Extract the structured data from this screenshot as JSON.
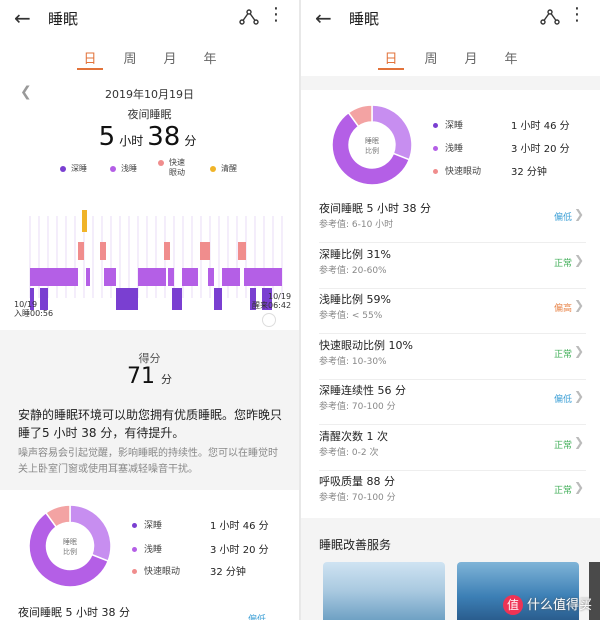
{
  "app": {
    "title": "睡眠"
  },
  "tabs": [
    "日",
    "周",
    "月",
    "年"
  ],
  "active_tab": "日",
  "day": {
    "date": "2019年10月19日",
    "night_sleep_label": "夜间睡眠",
    "duration": {
      "hours": "5",
      "hours_unit": "小时",
      "minutes": "38",
      "minutes_unit": "分"
    },
    "legend": [
      {
        "label": "深睡",
        "color": "#7a3fd1"
      },
      {
        "label": "浅睡",
        "color": "#b45fe6"
      },
      {
        "label": "快速\n眼动",
        "color": "#f08d8d"
      },
      {
        "label": "清醒",
        "color": "#f0b429"
      }
    ],
    "start_label": "10/19\n入睡00:56",
    "end_label": "10/19\n醒来06:42",
    "score_label": "得分",
    "score": "71",
    "score_unit": "分",
    "advice": "安静的睡眠环境可以助您拥有优质睡眠。您昨晚只睡了5 小时 38 分，有待提升。",
    "advice_detail": "噪声容易会引起觉醒，影响睡眠的持续性。您可以在睡觉时关上卧室门窗或使用耳塞减轻噪音干扰。"
  },
  "donut": {
    "center_label": "睡眠\n比例",
    "slices": [
      {
        "label": "深睡",
        "value": "1 小时 46 分",
        "percent": 31,
        "color": "#c78ef0"
      },
      {
        "label": "浅睡",
        "value": "3 小时 20 分",
        "percent": 59,
        "color": "#b45fe6"
      },
      {
        "label": "快速眼动",
        "value": "32 分钟",
        "percent": 10,
        "color": "#f3a3a3"
      }
    ]
  },
  "metrics": [
    {
      "title": "夜间睡眠  5 小时 38 分",
      "ref": "参考值: 6-10 小时",
      "status": "偏低",
      "level": "low"
    },
    {
      "title": "深睡比例  31%",
      "ref": "参考值: 20-60%",
      "status": "正常",
      "level": "norm"
    },
    {
      "title": "浅睡比例  59%",
      "ref": "参考值: < 55%",
      "status": "偏高",
      "level": "high"
    },
    {
      "title": "快速眼动比例  10%",
      "ref": "参考值: 10-30%",
      "status": "正常",
      "level": "norm"
    },
    {
      "title": "深睡连续性  56 分",
      "ref": "参考值: 70-100 分",
      "status": "偏低",
      "level": "low"
    },
    {
      "title": "清醒次数  1 次",
      "ref": "参考值: 0-2 次",
      "status": "正常",
      "level": "norm"
    },
    {
      "title": "呼吸质量  88 分",
      "ref": "参考值: 70-100 分",
      "status": "正常",
      "level": "norm"
    }
  ],
  "left_first_metric": {
    "title": "夜间睡眠  5 小时 38 分",
    "status": "偏低"
  },
  "service": {
    "title": "睡眠改善服务"
  },
  "watermark": "什么值得买",
  "watermark_badge": "值",
  "icons": {
    "back": "arrow-left-icon",
    "share": "share-icon",
    "more": "more-vertical-icon",
    "prev": "chevron-left-icon",
    "chevron": "chevron-right-icon"
  }
}
